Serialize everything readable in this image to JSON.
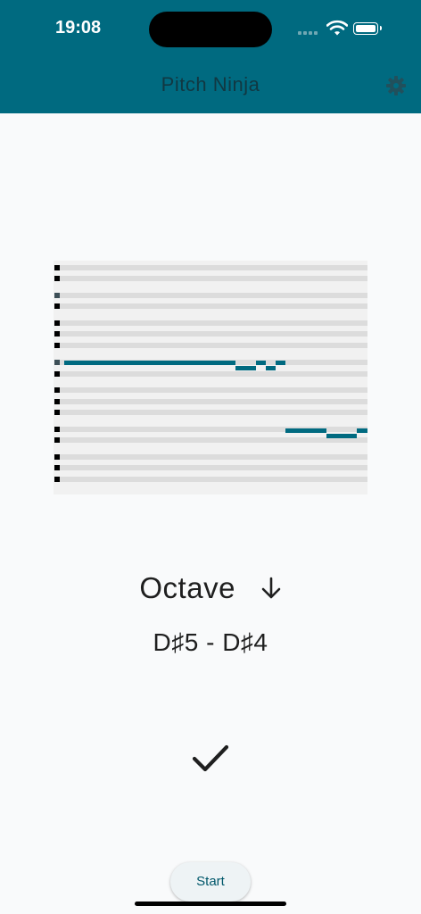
{
  "status_bar": {
    "time": "19:08"
  },
  "app_bar": {
    "title": "Pitch Ninja",
    "settings_icon": "gear-icon",
    "background_color": "#006a80"
  },
  "piano_roll": {
    "row_count": 20,
    "accent_color": "#006a80",
    "track_color": "#dcdcdc",
    "background_color": "#f1f1f1"
  },
  "exercise": {
    "interval_label": "Octave",
    "direction_icon": "arrow-down-icon",
    "notes_label": "D♯5 - D♯4",
    "result_icon": "checkmark-icon"
  },
  "controls": {
    "start_label": "Start"
  }
}
